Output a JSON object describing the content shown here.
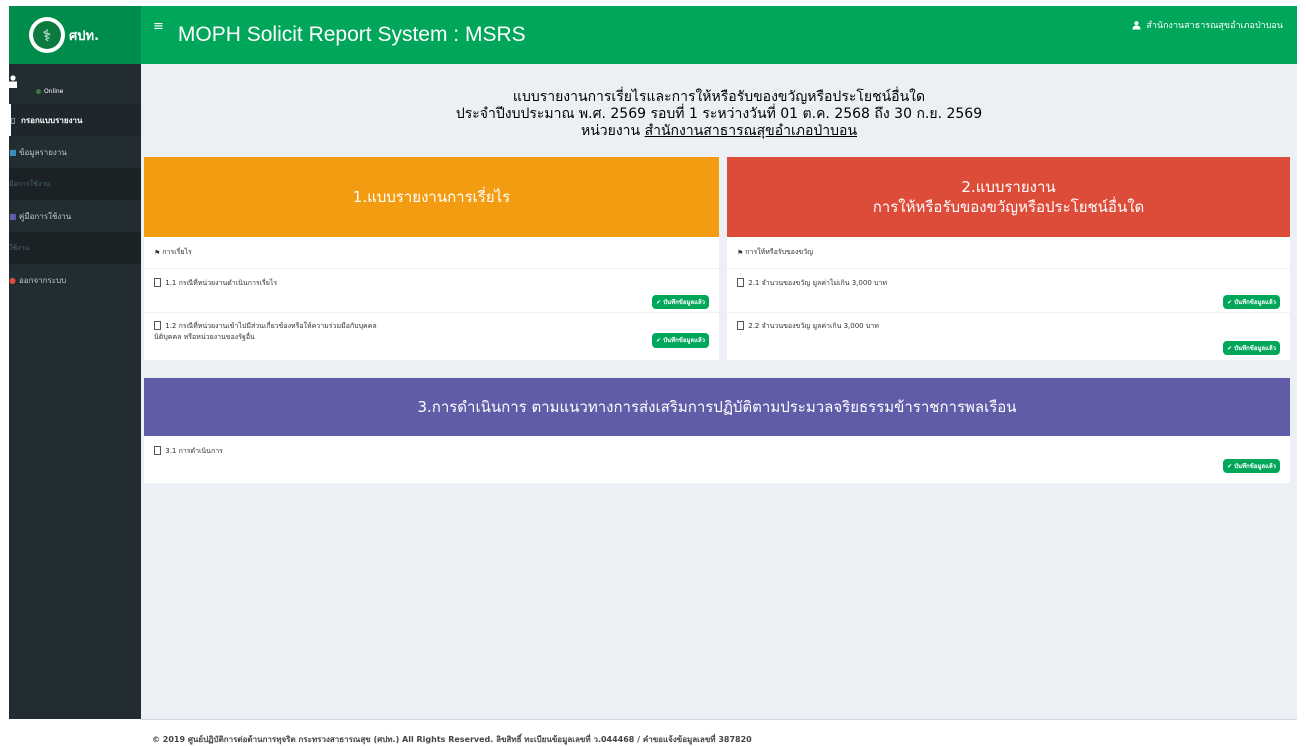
{
  "header": {
    "logo_text": "ศปท.",
    "logo_glyph": "⚕",
    "menu_icon": "≡",
    "title": "MOPH Solicit Report System : MSRS",
    "user_name": "สำนักงานสาธารณสุขอำเภอป่าบอน"
  },
  "sidebar": {
    "status": "Online",
    "items": [
      {
        "label": "กรอกแบบรายงาน",
        "kind": "active"
      },
      {
        "label": "ข้อมูลรายงาน",
        "kind": "item"
      },
      {
        "label": "มือการใช้งาน",
        "kind": "header"
      },
      {
        "label": "คู่มือการใช้งาน",
        "kind": "item"
      },
      {
        "label": "ใช้งาน",
        "kind": "header"
      },
      {
        "label": "ออกจากระบบ",
        "kind": "item"
      }
    ]
  },
  "report_header": {
    "line1": "แบบรายงานการเรี่ยไรและการให้หรือรับของขวัญหรือประโยชน์อื่นใด",
    "line2": "ประจำปีงบประมาณ พ.ศ. 2569 รอบที่ 1 ระหว่างวันที่ 01 ต.ค. 2568 ถึง 30 ก.ย. 2569",
    "unit_prefix": "หน่วยงาน",
    "unit_name": "สำนักงานสาธารณสุขอำเภอป่าบอน"
  },
  "panels": {
    "p1": {
      "title": "1.แบบรายงานการเรี่ยไร",
      "subheading": "การเรี่ยไร",
      "items": [
        {
          "label": "1.1 กรณีที่หน่วยงานดำเนินการเรี่ยไร",
          "badge": "✔ บันทึกข้อมูลแล้ว"
        },
        {
          "label": "1.2 กรณีที่หน่วยงานเข้าไปมีส่วนเกี่ยวข้องหรือให้ความร่วมมือกับบุคคล",
          "label2": "นิติบุคคล หรือหน่วยงานของรัฐอื่น",
          "badge": "✔ บันทึกข้อมูลแล้ว"
        }
      ]
    },
    "p2": {
      "title_line1": "2.แบบรายงาน",
      "title_line2": "การให้หรือรับของขวัญหรือประโยชน์อื่นใด",
      "subheading": "การให้หรือรับของขวัญ",
      "items": [
        {
          "label": "2.1 จำนวนของขวัญ มูลค่าไม่เกิน 3,000 บาท",
          "badge": "✔ บันทึกข้อมูลแล้ว"
        },
        {
          "label": "2.2 จำนวนของขวัญ มูลค่าเกิน 3,000 บาท",
          "badge": "✔ บันทึกข้อมูลแล้ว"
        }
      ]
    },
    "p3": {
      "title": "3.การดำเนินการ ตามแนวทางการส่งเสริมการปฏิบัติตามประมวลจริยธรรมข้าราชการพลเรือน",
      "items": [
        {
          "label": "3.1 การดำเนินการ",
          "badge": "✔ บันทึกข้อมูลแล้ว"
        }
      ]
    }
  },
  "footer": {
    "text": "© 2019 ศูนย์ปฏิบัติการต่อต้านการทุจริต กระทรวงสาธารณสุข (ศปท.) All Rights Reserved. ลิขสิทธิ์ ทะเบียนข้อมูลเลขที่ ว.044468 / คำขอแจ้งข้อมูลเลขที่ 387820"
  },
  "colors": {
    "header_green": "#00a65a",
    "sidebar_dark": "#222d32",
    "panel1_orange": "#f39c12",
    "panel2_red": "#dd4b39",
    "panel3_purple": "#605ca8",
    "badge_green": "#00a65a"
  }
}
